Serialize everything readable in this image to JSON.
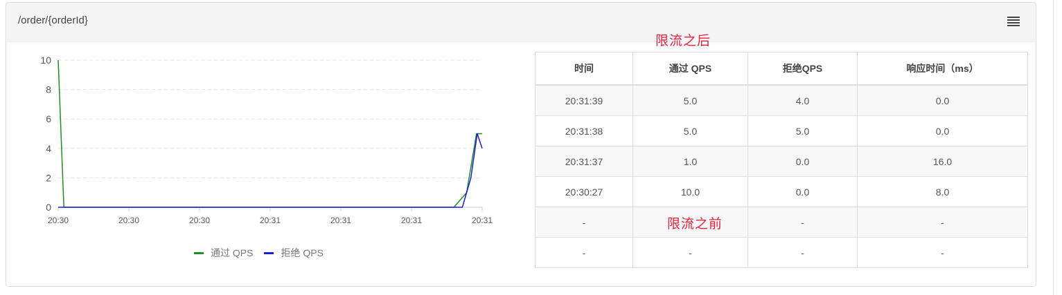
{
  "panel": {
    "title": "/order/{orderId}",
    "menu_icon": "menu-icon"
  },
  "annotations": {
    "after": "限流之后",
    "before": "限流之前"
  },
  "chart_data": {
    "type": "line",
    "x": [
      "20:30",
      "20:30",
      "20:30",
      "20:31",
      "20:31",
      "20:31",
      "20:31"
    ],
    "y_ticks": [
      0,
      2,
      4,
      6,
      8,
      10
    ],
    "ylim": [
      0,
      10
    ],
    "grid": true,
    "legend_position": "bottom",
    "series": [
      {
        "name": "通过 QPS",
        "color": "#228b22",
        "points": [
          [
            0,
            10
          ],
          [
            0.08,
            0
          ],
          [
            5.6,
            0
          ],
          [
            5.78,
            1
          ],
          [
            5.92,
            5
          ],
          [
            6,
            5
          ]
        ]
      },
      {
        "name": "拒绝 QPS",
        "color": "#1a1add",
        "points": [
          [
            0,
            0
          ],
          [
            5.72,
            0
          ],
          [
            5.84,
            2
          ],
          [
            5.93,
            5
          ],
          [
            6,
            4
          ]
        ]
      }
    ]
  },
  "legend": {
    "pass_label": "通过 QPS",
    "reject_label": "拒绝 QPS"
  },
  "table": {
    "headers": [
      "时间",
      "通过 QPS",
      "拒绝QPS",
      "响应时间（ms）"
    ],
    "rows": [
      [
        "20:31:39",
        "5.0",
        "4.0",
        "0.0"
      ],
      [
        "20:31:38",
        "5.0",
        "5.0",
        "0.0"
      ],
      [
        "20:31:37",
        "1.0",
        "0.0",
        "16.0"
      ],
      [
        "20:30:27",
        "10.0",
        "0.0",
        "8.0"
      ],
      [
        "-",
        "-",
        "-",
        "-"
      ],
      [
        "-",
        "-",
        "-",
        "-"
      ]
    ]
  }
}
